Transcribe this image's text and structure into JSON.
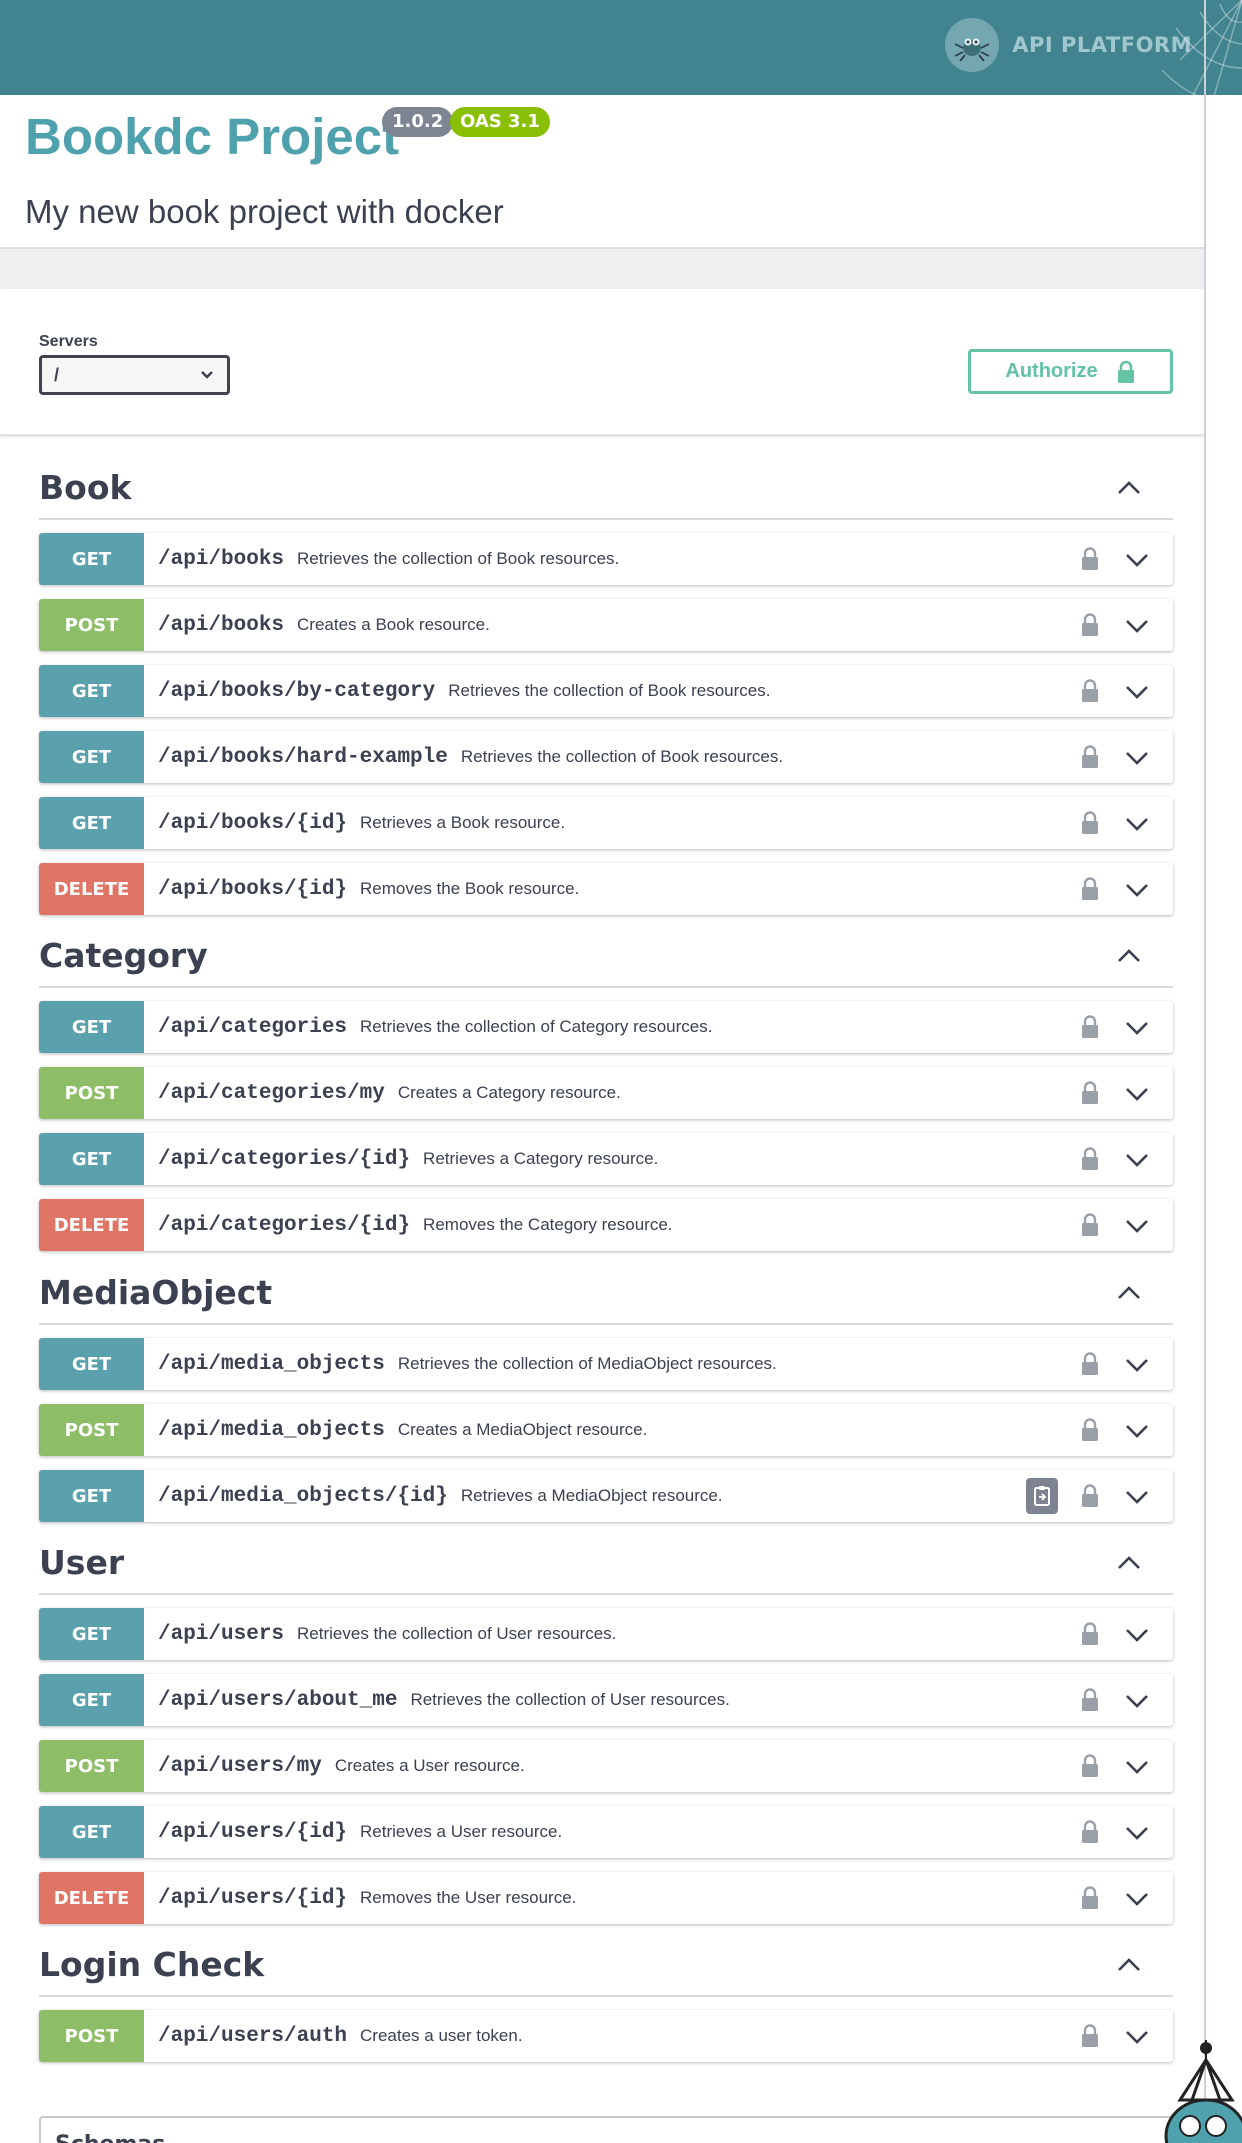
{
  "header": {
    "brand_text": "API PLATFORM"
  },
  "info": {
    "title": "Bookdc Project",
    "version": "1.0.2",
    "oas": "OAS 3.1",
    "description": "My new book project with docker"
  },
  "servers": {
    "label": "Servers",
    "selected": "/"
  },
  "authorize_label": "Authorize",
  "colors": {
    "get": "#5aa1ad",
    "post": "#8dbe67",
    "delete": "#e07566",
    "topbar": "#41848f",
    "title": "#4fa1ad"
  },
  "sections": [
    {
      "name": "Book",
      "operations": [
        {
          "method": "GET",
          "path": "/api/books",
          "summary": "Retrieves the collection of Book resources."
        },
        {
          "method": "POST",
          "path": "/api/books",
          "summary": "Creates a Book resource."
        },
        {
          "method": "GET",
          "path": "/api/books/by-category",
          "summary": "Retrieves the collection of Book resources."
        },
        {
          "method": "GET",
          "path": "/api/books/hard-example",
          "summary": "Retrieves the collection of Book resources."
        },
        {
          "method": "GET",
          "path": "/api/books/{id}",
          "summary": "Retrieves a Book resource."
        },
        {
          "method": "DELETE",
          "path": "/api/books/{id}",
          "summary": "Removes the Book resource."
        }
      ]
    },
    {
      "name": "Category",
      "operations": [
        {
          "method": "GET",
          "path": "/api/categories",
          "summary": "Retrieves the collection of Category resources."
        },
        {
          "method": "POST",
          "path": "/api/categories/my",
          "summary": "Creates a Category resource."
        },
        {
          "method": "GET",
          "path": "/api/categories/{id}",
          "summary": "Retrieves a Category resource."
        },
        {
          "method": "DELETE",
          "path": "/api/categories/{id}",
          "summary": "Removes the Category resource."
        }
      ]
    },
    {
      "name": "MediaObject",
      "operations": [
        {
          "method": "GET",
          "path": "/api/media_objects",
          "summary": "Retrieves the collection of MediaObject resources."
        },
        {
          "method": "POST",
          "path": "/api/media_objects",
          "summary": "Creates a MediaObject resource."
        },
        {
          "method": "GET",
          "path": "/api/media_objects/{id}",
          "summary": "Retrieves a MediaObject resource.",
          "copy_icon": true
        }
      ]
    },
    {
      "name": "User",
      "operations": [
        {
          "method": "GET",
          "path": "/api/users",
          "summary": "Retrieves the collection of User resources."
        },
        {
          "method": "GET",
          "path": "/api/users/about_me",
          "summary": "Retrieves the collection of User resources."
        },
        {
          "method": "POST",
          "path": "/api/users/my",
          "summary": "Creates a User resource."
        },
        {
          "method": "GET",
          "path": "/api/users/{id}",
          "summary": "Retrieves a User resource."
        },
        {
          "method": "DELETE",
          "path": "/api/users/{id}",
          "summary": "Removes the User resource."
        }
      ]
    },
    {
      "name": "Login Check",
      "operations": [
        {
          "method": "POST",
          "path": "/api/users/auth",
          "summary": "Creates a user token."
        }
      ]
    }
  ],
  "schemas_title": "Schemas"
}
